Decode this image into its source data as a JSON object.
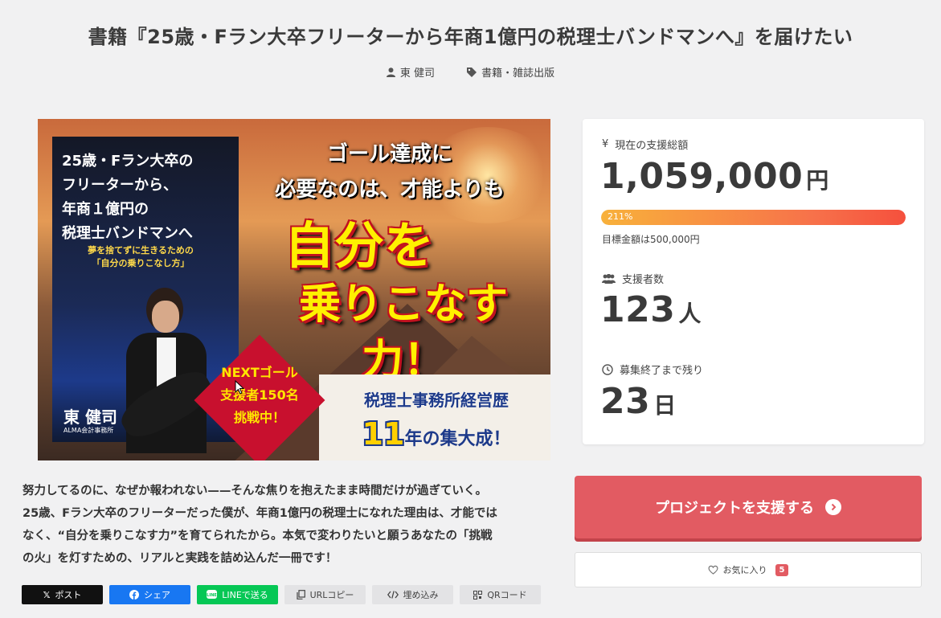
{
  "project": {
    "title": "書籍『25歳・Fラン大卒フリーターから年商1億円の税理士バンドマンへ』を届けたい",
    "author": "東 健司",
    "category": "書籍・雑誌出版"
  },
  "hero": {
    "left_title_lines": [
      "25歳・Fラン大卒の",
      "フリーターから、",
      "年商１億円の",
      "税理士バンドマンへ"
    ],
    "left_subtitle_lines": [
      "夢を捨てずに生きるための",
      "「自分の乗りこなし方」"
    ],
    "heading_top_lines": [
      "ゴール達成に",
      "必要なのは、才能よりも"
    ],
    "big_line1": "自分を",
    "big_line2": "乗りこなす力！",
    "next_goal_lines": [
      "NEXTゴール",
      "支援者150名",
      "挑戦中！"
    ],
    "banner_line1": "税理士事務所経営歴",
    "banner_num": "11",
    "banner_line2_suffix": "年の集大成！",
    "person_name": "東 健司",
    "person_org": "ALMA会計事務所"
  },
  "stats": {
    "amount_label": "現在の支援総額",
    "amount_value": "1,059,000",
    "amount_unit": "円",
    "progress_fraction": 1.0,
    "progress_text": "211%",
    "goal_text": "目標金額は500,000円",
    "supporters_label": "支援者数",
    "supporters_value": "123",
    "supporters_unit": "人",
    "remaining_label": "募集終了まで残り",
    "remaining_value": "23",
    "remaining_unit": "日"
  },
  "description_lines": [
    "努力してるのに、なぜか報われない——そんな焦りを抱えたまま時間だけが過ぎていく。",
    "25歳、Fラン大卒のフリーターだった僕が、年商1億円の税理士になれた理由は、才能では",
    "なく、“自分を乗りこなす力”を育てられたから。本気で変わりたいと願うあなたの「挑戦",
    "の火」を灯すための、リアルと実践を詰め込んだ一冊です！"
  ],
  "share": {
    "x": "ポスト",
    "facebook": "シェア",
    "line": "LINEで送る",
    "url_copy": "URLコピー",
    "embed": "埋め込み",
    "qr": "QRコード"
  },
  "actions": {
    "support_label": "プロジェクトを支援する",
    "favorite_label": "お気に入り",
    "favorite_count": "5"
  },
  "colors": {
    "accent": "#e25b62",
    "facebook": "#1877f2",
    "line": "#06c755",
    "x": "#111111"
  }
}
